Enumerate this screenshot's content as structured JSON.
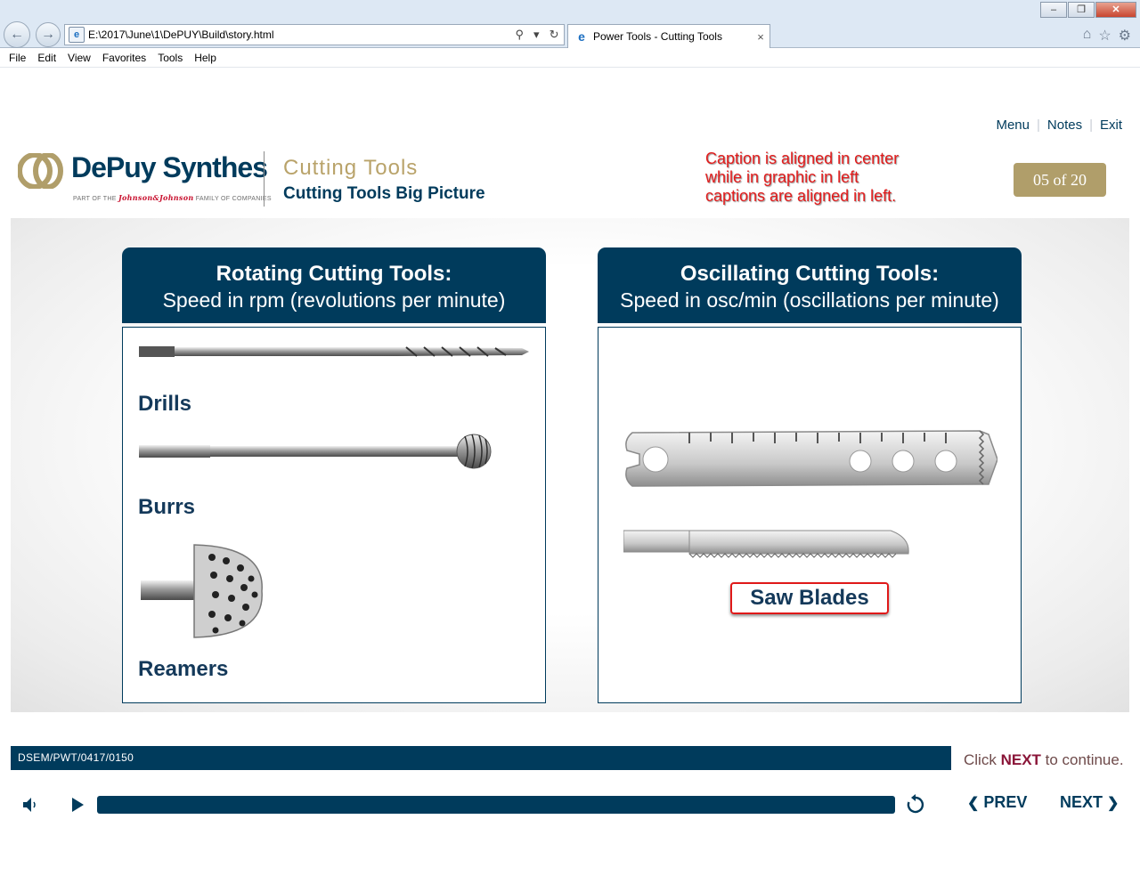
{
  "browser": {
    "url": "E:\\2017\\June\\1\\DePUY\\Build\\story.html",
    "tab_title": "Power Tools - Cutting Tools",
    "tab_close": "×",
    "menu": [
      "File",
      "Edit",
      "View",
      "Favorites",
      "Tools",
      "Help"
    ],
    "window_buttons": [
      "–",
      "❐",
      "✕"
    ]
  },
  "top_nav": {
    "menu": "Menu",
    "notes": "Notes",
    "exit": "Exit",
    "separator": "|"
  },
  "logo": {
    "brand": "DePuy Synthes",
    "family_prefix": "PART OF THE",
    "family_name": "Johnson&Johnson",
    "family_suffix": "FAMILY OF COMPANIES"
  },
  "header": {
    "section": "Cutting Tools",
    "subtitle": "Cutting Tools Big Picture"
  },
  "review_note": "Caption is aligned in center\nwhile in graphic in left\ncaptions are aligned in left.",
  "slide_counter": "05 of 20",
  "panels": {
    "left": {
      "title": "Rotating Cutting Tools:",
      "subtitle": "Speed in rpm (revolutions per minute)",
      "items": [
        "Drills",
        "Burrs",
        "Reamers"
      ]
    },
    "right": {
      "title": "Oscillating Cutting Tools:",
      "subtitle": "Speed in osc/min (oscillations per minute)",
      "caption": "Saw Blades"
    }
  },
  "footer": {
    "code": "DSEM/PWT/0417/0150",
    "cta_prefix": "Click",
    "cta_keyword": "NEXT",
    "cta_suffix": "to continue."
  },
  "player": {
    "prev_label": "PREV",
    "next_label": "NEXT",
    "progress": 1.0
  },
  "colors": {
    "navy": "#003b5c",
    "gold": "#b09e6a",
    "annotation_red": "#e21b1b"
  }
}
